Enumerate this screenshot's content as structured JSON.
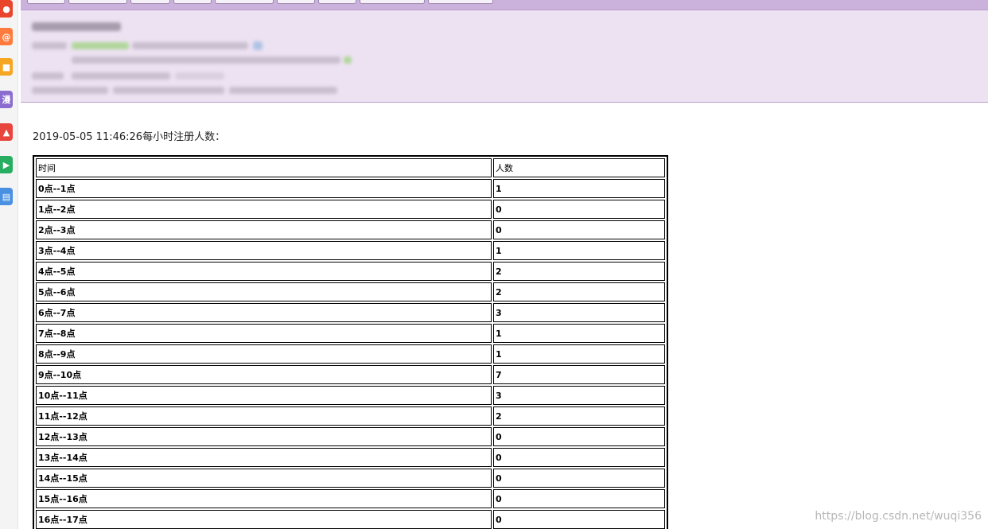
{
  "left_strip": {
    "icons": [
      {
        "name": "weibo-icon",
        "glyph": "●",
        "color": "#e8452c"
      },
      {
        "name": "at-mail-icon",
        "glyph": "@",
        "color": "#ff7a3d"
      },
      {
        "name": "folder-icon",
        "glyph": "■",
        "color": "#f5a623"
      },
      {
        "name": "comic-icon",
        "glyph": "漫",
        "color": "#8b6ccf"
      },
      {
        "name": "game-icon",
        "glyph": "▲",
        "color": "#e8453c"
      },
      {
        "name": "video-icon",
        "glyph": "▶",
        "color": "#27ae60"
      },
      {
        "name": "note-icon",
        "glyph": "▤",
        "color": "#4a90e2"
      }
    ]
  },
  "report": {
    "title": "2019-05-05 11:46:26每小时注册人数：",
    "header": {
      "time": "时间",
      "count": "人数"
    },
    "rows": [
      {
        "time": "0点--1点",
        "count": "1"
      },
      {
        "time": "1点--2点",
        "count": "0"
      },
      {
        "time": "2点--3点",
        "count": "0"
      },
      {
        "time": "3点--4点",
        "count": "1"
      },
      {
        "time": "4点--5点",
        "count": "2"
      },
      {
        "time": "5点--6点",
        "count": "2"
      },
      {
        "time": "6点--7点",
        "count": "3"
      },
      {
        "time": "7点--8点",
        "count": "1"
      },
      {
        "time": "8点--9点",
        "count": "1"
      },
      {
        "time": "9点--10点",
        "count": "7"
      },
      {
        "time": "10点--11点",
        "count": "3"
      },
      {
        "time": "11点--12点",
        "count": "2"
      },
      {
        "time": "12点--13点",
        "count": "0"
      },
      {
        "time": "13点--14点",
        "count": "0"
      },
      {
        "time": "14点--15点",
        "count": "0"
      },
      {
        "time": "15点--16点",
        "count": "0"
      },
      {
        "time": "16点--17点",
        "count": "0"
      }
    ]
  },
  "watermark": "https://blog.csdn.net/wuqi356"
}
